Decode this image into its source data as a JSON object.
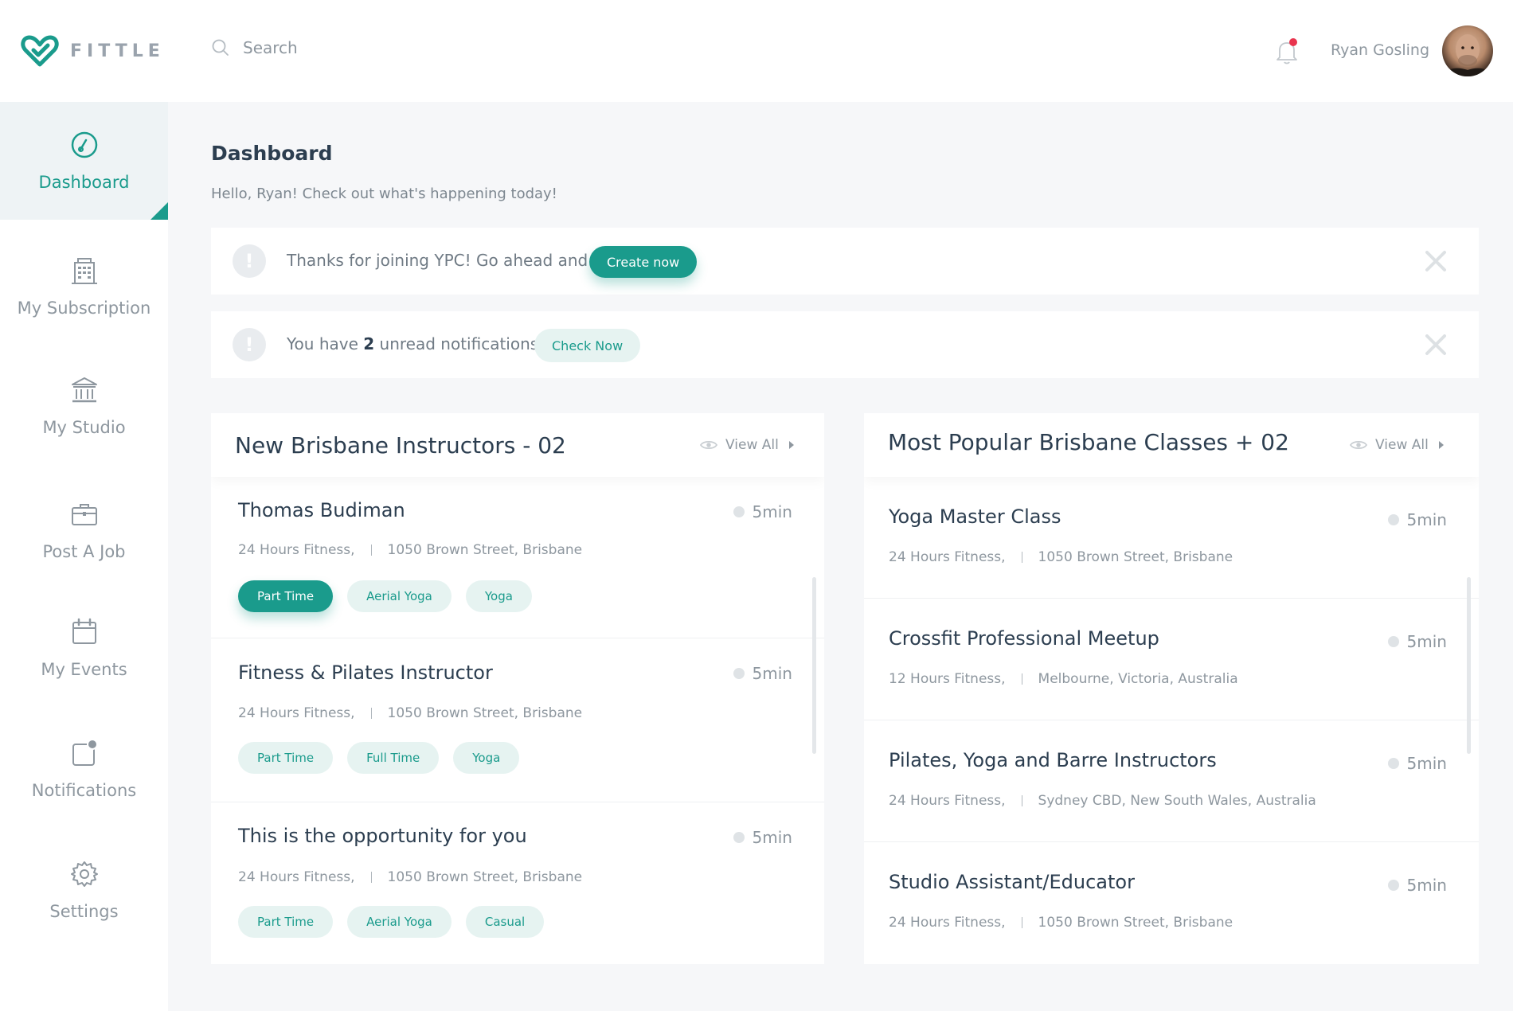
{
  "app": {
    "logo_text": "FITTLE",
    "brand_color": "#1a9b8c"
  },
  "sidebar": {
    "items": [
      {
        "label": "Dashboard",
        "icon": "gauge-icon",
        "active": true
      },
      {
        "label": "My Subscription",
        "icon": "building-icon",
        "active": false
      },
      {
        "label": "My Studio",
        "icon": "studio-icon",
        "active": false
      },
      {
        "label": "Post A Job",
        "icon": "briefcase-icon",
        "active": false
      },
      {
        "label": "My Events",
        "icon": "calendar-icon",
        "active": false
      },
      {
        "label": "Notifications",
        "icon": "notification-icon",
        "active": false
      },
      {
        "label": "Settings",
        "icon": "gear-icon",
        "active": false
      }
    ]
  },
  "header": {
    "search_placeholder": "Search",
    "user_name": "Ryan Gosling"
  },
  "main": {
    "title": "Dashboard",
    "subtitle": "Hello, Ryan! Check out what's happening today!"
  },
  "alerts": [
    {
      "text": "Thanks for joining YPC! Go ahead and",
      "button": "Create now"
    },
    {
      "text_before": "You have",
      "count": "2",
      "text_after": "unread notifications.",
      "button": "Check Now"
    }
  ],
  "instructors": {
    "title": "New Brisbane Instructors - 02",
    "view_all": "View All",
    "items": [
      {
        "title": "Thomas Budiman",
        "gym": "24 Hours Fitness,",
        "location": "1050 Brown Street, Brisbane",
        "time": "5min",
        "tags": [
          "Part Time",
          "Aerial Yoga",
          "Yoga"
        ]
      },
      {
        "title": "Fitness & Pilates Instructor",
        "gym": "24 Hours Fitness,",
        "location": "1050 Brown Street, Brisbane",
        "time": "5min",
        "tags": [
          "Part Time",
          "Full Time",
          "Yoga"
        ]
      },
      {
        "title": "This is the opportunity for you",
        "gym": "24 Hours Fitness,",
        "location": "1050 Brown Street, Brisbane",
        "time": "5min",
        "tags": [
          "Part Time",
          "Aerial Yoga",
          "Casual"
        ]
      }
    ]
  },
  "classes": {
    "title": "Most Popular Brisbane Classes + 02",
    "view_all": "View All",
    "items": [
      {
        "title": "Yoga Master Class",
        "gym": "24 Hours Fitness,",
        "location": "1050 Brown Street, Brisbane",
        "time": "5min"
      },
      {
        "title": "Crossfit Professional Meetup",
        "gym": "12 Hours Fitness,",
        "location": "Melbourne, Victoria, Australia",
        "time": "5min"
      },
      {
        "title": "Pilates, Yoga and Barre Instructors",
        "gym": "24 Hours Fitness,",
        "location": "Sydney CBD, New South Wales, Australia",
        "time": "5min"
      },
      {
        "title": "Studio Assistant/Educator",
        "gym": "24 Hours Fitness,",
        "location": "1050 Brown Street, Brisbane",
        "time": "5min"
      }
    ]
  }
}
